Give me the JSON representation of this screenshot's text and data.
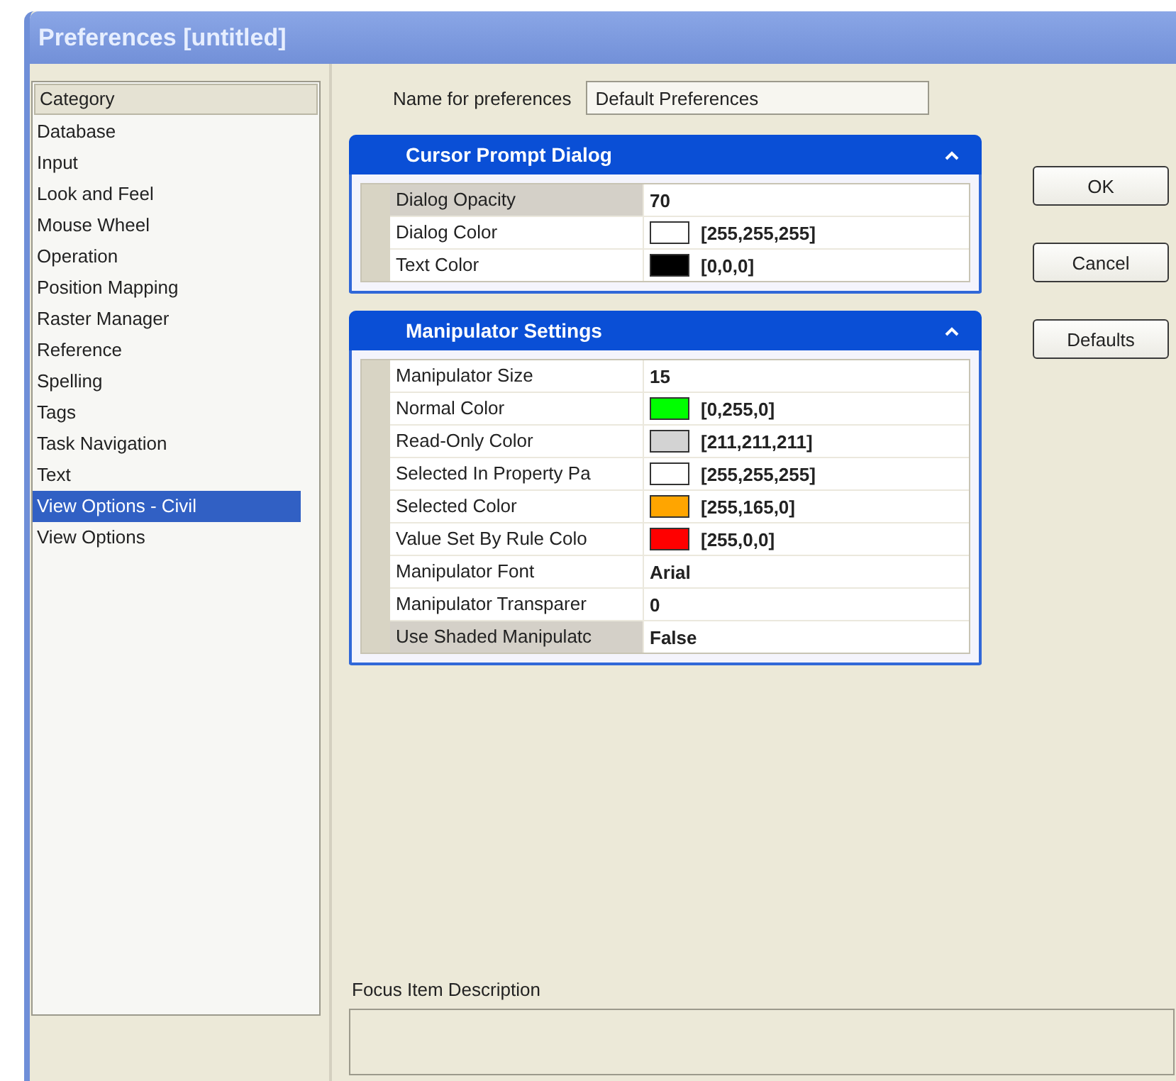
{
  "window": {
    "title": "Preferences [untitled]"
  },
  "category_list": {
    "header": "Category",
    "items": [
      {
        "label": "Database",
        "selected": false
      },
      {
        "label": "Input",
        "selected": false
      },
      {
        "label": "Look and Feel",
        "selected": false
      },
      {
        "label": "Mouse Wheel",
        "selected": false
      },
      {
        "label": "Operation",
        "selected": false
      },
      {
        "label": "Position Mapping",
        "selected": false
      },
      {
        "label": "Raster Manager",
        "selected": false
      },
      {
        "label": "Reference",
        "selected": false
      },
      {
        "label": "Spelling",
        "selected": false
      },
      {
        "label": "Tags",
        "selected": false
      },
      {
        "label": "Task Navigation",
        "selected": false
      },
      {
        "label": "Text",
        "selected": false
      },
      {
        "label": "View Options - Civil",
        "selected": true
      },
      {
        "label": "View Options",
        "selected": false
      }
    ]
  },
  "name_field": {
    "label": "Name for preferences",
    "value": "Default Preferences"
  },
  "sections": [
    {
      "title": "Cursor Prompt Dialog",
      "expanded": true,
      "rows": [
        {
          "kind": "text",
          "label": "Dialog Opacity",
          "value": "70",
          "selected": true
        },
        {
          "kind": "color",
          "label": "Dialog Color",
          "value": "[255,255,255]",
          "color": "#ffffff",
          "selected": false
        },
        {
          "kind": "color",
          "label": "Text Color",
          "value": "[0,0,0]",
          "color": "#000000",
          "selected": false
        }
      ]
    },
    {
      "title": "Manipulator Settings",
      "expanded": true,
      "rows": [
        {
          "kind": "text",
          "label": "Manipulator Size",
          "value": "15",
          "selected": false
        },
        {
          "kind": "color",
          "label": "Normal Color",
          "value": "[0,255,0]",
          "color": "#00ff00",
          "selected": false
        },
        {
          "kind": "color",
          "label": "Read-Only Color",
          "value": "[211,211,211]",
          "color": "#d3d3d3",
          "selected": false
        },
        {
          "kind": "color",
          "label": "Selected In Property Pa",
          "value": "[255,255,255]",
          "color": "#ffffff",
          "selected": false
        },
        {
          "kind": "color",
          "label": "Selected Color",
          "value": "[255,165,0]",
          "color": "#ffa500",
          "selected": false
        },
        {
          "kind": "color",
          "label": "Value Set By Rule Colo",
          "value": "[255,0,0]",
          "color": "#ff0000",
          "selected": false
        },
        {
          "kind": "text",
          "label": "Manipulator Font",
          "value": "Arial",
          "selected": false
        },
        {
          "kind": "text",
          "label": "Manipulator Transparer",
          "value": "0",
          "selected": false
        },
        {
          "kind": "text",
          "label": "Use Shaded Manipulatc",
          "value": "False",
          "selected": true
        }
      ]
    }
  ],
  "buttons": [
    "OK",
    "Cancel",
    "Defaults"
  ],
  "description": {
    "label": "Focus Item Description"
  }
}
